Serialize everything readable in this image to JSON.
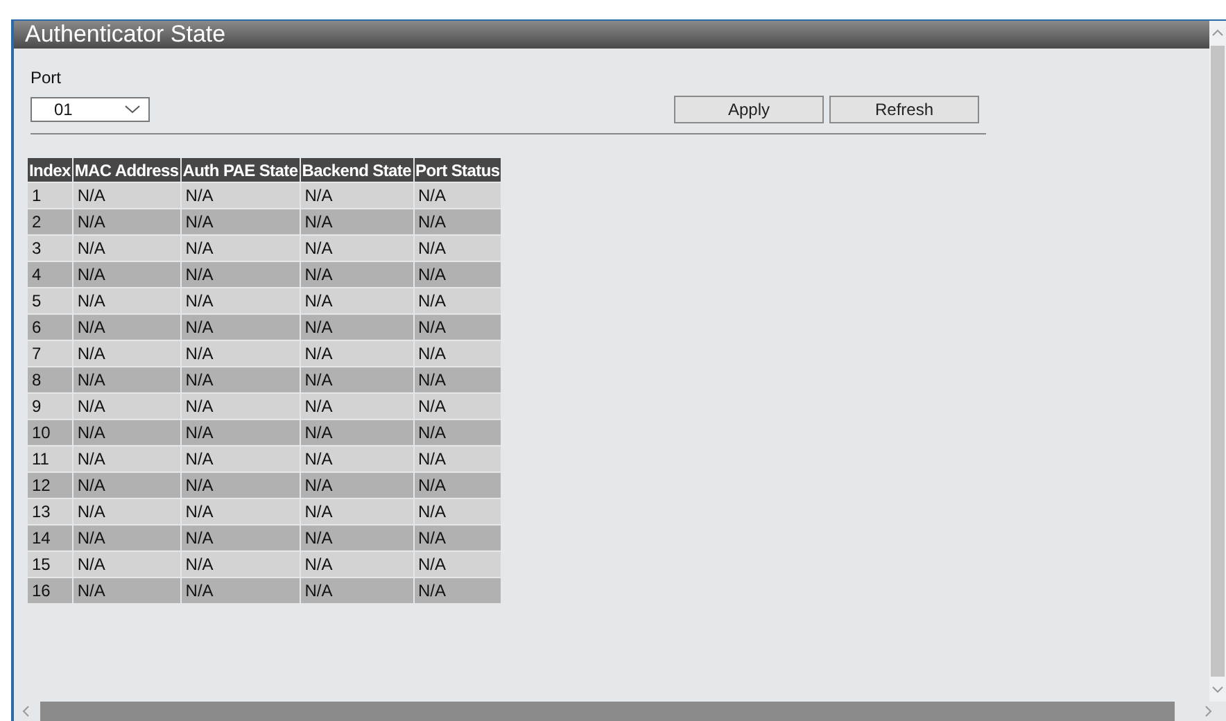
{
  "panel": {
    "title": "Authenticator State"
  },
  "port": {
    "label": "Port",
    "value": "01"
  },
  "buttons": [
    "Apply",
    "Refresh"
  ],
  "table": {
    "columns": [
      "Index",
      "MAC Address",
      "Auth PAE State",
      "Backend State",
      "Port Status"
    ],
    "rows": [
      [
        "1",
        "N/A",
        "N/A",
        "N/A",
        "N/A"
      ],
      [
        "2",
        "N/A",
        "N/A",
        "N/A",
        "N/A"
      ],
      [
        "3",
        "N/A",
        "N/A",
        "N/A",
        "N/A"
      ],
      [
        "4",
        "N/A",
        "N/A",
        "N/A",
        "N/A"
      ],
      [
        "5",
        "N/A",
        "N/A",
        "N/A",
        "N/A"
      ],
      [
        "6",
        "N/A",
        "N/A",
        "N/A",
        "N/A"
      ],
      [
        "7",
        "N/A",
        "N/A",
        "N/A",
        "N/A"
      ],
      [
        "8",
        "N/A",
        "N/A",
        "N/A",
        "N/A"
      ],
      [
        "9",
        "N/A",
        "N/A",
        "N/A",
        "N/A"
      ],
      [
        "10",
        "N/A",
        "N/A",
        "N/A",
        "N/A"
      ],
      [
        "11",
        "N/A",
        "N/A",
        "N/A",
        "N/A"
      ],
      [
        "12",
        "N/A",
        "N/A",
        "N/A",
        "N/A"
      ],
      [
        "13",
        "N/A",
        "N/A",
        "N/A",
        "N/A"
      ],
      [
        "14",
        "N/A",
        "N/A",
        "N/A",
        "N/A"
      ],
      [
        "15",
        "N/A",
        "N/A",
        "N/A",
        "N/A"
      ],
      [
        "16",
        "N/A",
        "N/A",
        "N/A",
        "N/A"
      ]
    ]
  }
}
